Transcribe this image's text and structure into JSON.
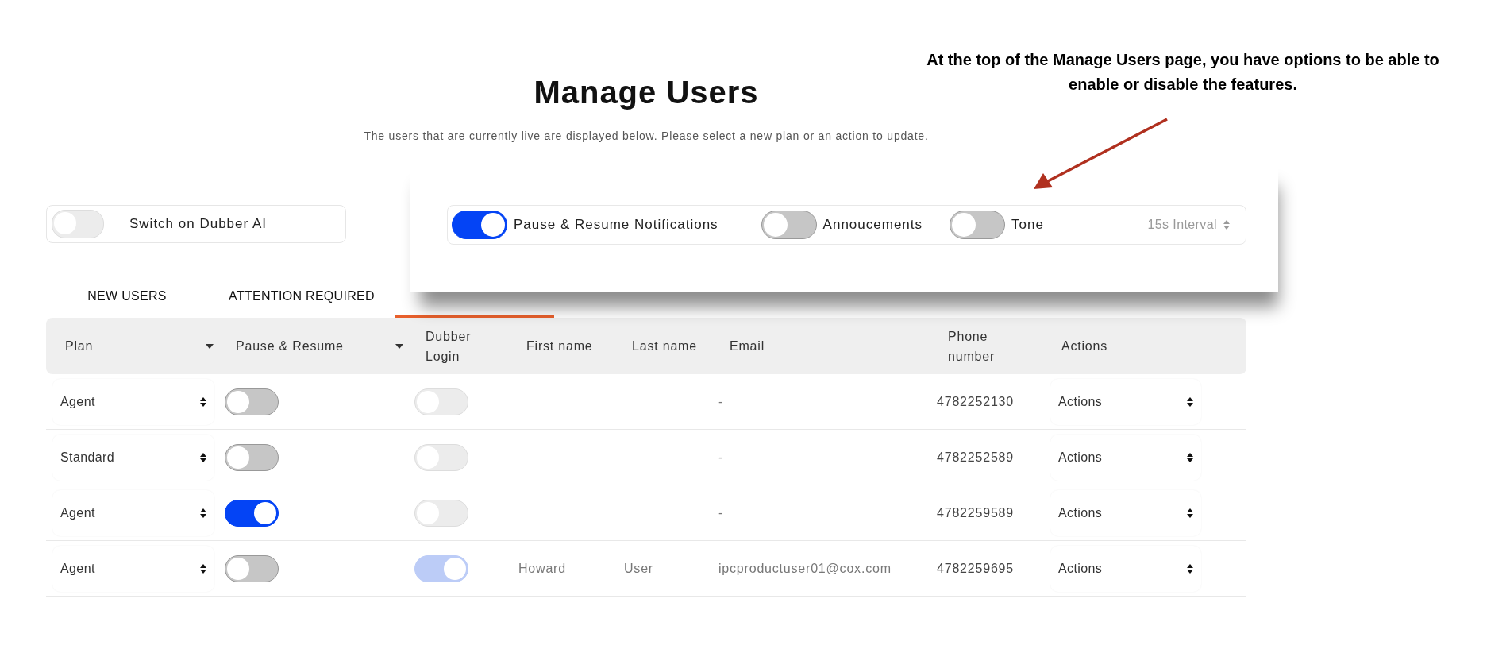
{
  "page": {
    "title": "Manage Users",
    "subtitle": "The users that are currently live are displayed below. Please select a new plan or an action to update."
  },
  "annotation": {
    "text": "At the top of the Manage Users page, you have options to be able to enable or disable the features."
  },
  "dubber_ai": {
    "label": "Switch on Dubber AI",
    "on": false
  },
  "tabs": [
    {
      "label": "NEW USERS",
      "selected": false
    },
    {
      "label": "ATTENTION REQUIRED",
      "selected": false
    },
    {
      "selected": true
    }
  ],
  "popup": {
    "toggles": [
      {
        "label": "Pause & Resume Notifications",
        "on": true
      },
      {
        "label": "Annoucements",
        "on": false
      },
      {
        "label": "Tone",
        "on": false
      }
    ],
    "interval": "15s Interval"
  },
  "table": {
    "columns": [
      {
        "label": "Plan",
        "sortable": true
      },
      {
        "label": "Pause & Resume",
        "sortable": true
      },
      {
        "label": "Dubber Login",
        "sortable": false
      },
      {
        "label": "First name",
        "sortable": false
      },
      {
        "label": "Last name",
        "sortable": false
      },
      {
        "label": "Email",
        "sortable": false
      },
      {
        "label": "Phone number",
        "sortable": false
      },
      {
        "label": "Actions",
        "sortable": false
      }
    ],
    "rows": [
      {
        "plan": "Agent",
        "pause_resume": {
          "on": false
        },
        "dubber_login": {
          "on": false,
          "disabled": true
        },
        "email": "-",
        "phone": "4782252130",
        "action": "Actions"
      },
      {
        "plan": "Standard",
        "pause_resume": {
          "on": false
        },
        "dubber_login": {
          "on": false,
          "disabled": true
        },
        "email": "-",
        "phone": "4782252589",
        "action": "Actions"
      },
      {
        "plan": "Agent",
        "pause_resume": {
          "on": true
        },
        "dubber_login": {
          "on": false,
          "disabled": true
        },
        "email": "-",
        "phone": "4782259589",
        "action": "Actions"
      },
      {
        "plan": "Agent",
        "pause_resume": {
          "on": false
        },
        "dubber_login": {
          "on": true,
          "disabled": true
        },
        "first_name": "Howard",
        "last_name": "User",
        "email": "ipcproductuser01@cox.com",
        "phone": "4782259695",
        "action": "Actions"
      }
    ]
  }
}
